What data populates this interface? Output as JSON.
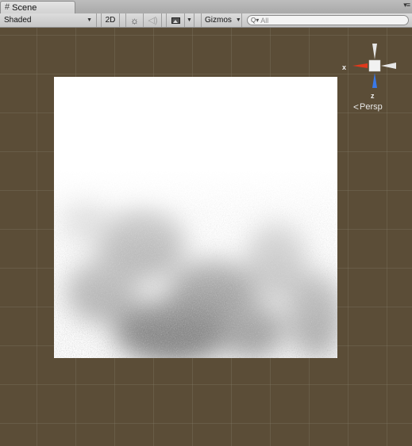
{
  "window": {
    "tab_title": "Scene",
    "tab_icon": "grid-icon",
    "menu_icon": "window-menu-icon"
  },
  "toolbar": {
    "draw_mode": "Shaded",
    "mode_2d": "2D",
    "lighting_icon": "sun-icon",
    "audio_icon": "speaker-icon",
    "effects_icon": "image-icon",
    "gizmos": "Gizmos",
    "search_placeholder": "All"
  },
  "scene_gizmo": {
    "x_label": "x",
    "z_label": "z",
    "projection": "Persp",
    "colors": {
      "x": "#e0391c",
      "z": "#3a79e8",
      "y": "#d9d9d9"
    }
  },
  "scene": {
    "background": "#5b4d37",
    "object": "noise-texture-quad"
  }
}
